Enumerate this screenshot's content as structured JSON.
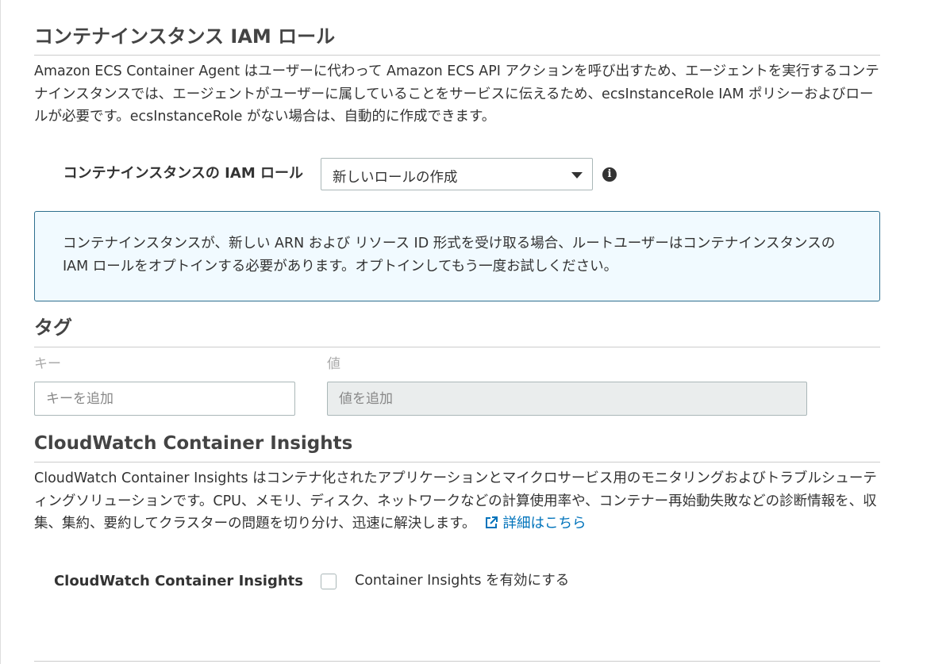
{
  "iam_section": {
    "title": "コンテナインスタンス IAM ロール",
    "description": "Amazon ECS Container Agent はユーザーに代わって Amazon ECS API アクションを呼び出すため、エージェントを実行するコンテナインスタンスでは、エージェントがユーザーに属していることをサービスに伝えるため、ecsInstanceRole IAM ポリシーおよびロールが必要です。ecsInstanceRole がない場合は、自動的に作成できます。",
    "role_label": "コンテナインスタンスの IAM ロール",
    "role_select_value": "新しいロールの作成",
    "info_icon": "info-icon",
    "notice": "コンテナインスタンスが、新しい ARN および リソース ID 形式を受け取る場合、ルートユーザーはコンテナインスタンスの IAM ロールをオプトインする必要があります。オプトインしてもう一度お試しください。"
  },
  "tags_section": {
    "title": "タグ",
    "key_label": "キー",
    "value_label": "値",
    "key_placeholder": "キーを追加",
    "value_placeholder": "値を追加"
  },
  "insights_section": {
    "title": "CloudWatch Container Insights",
    "description": "CloudWatch Container Insights はコンテナ化されたアプリケーションとマイクロサービス用のモニタリングおよびトラブルシューティングソリューションです。CPU、メモリ、ディスク、ネットワークなどの計算使用率や、コンテナー再始動失敗などの診断情報を、収集、集約、要約してクラスターの問題を切り分け、迅速に解決します。",
    "learn_more_link": "詳細はこちら",
    "link_icon": "external-link-icon",
    "checkbox_label_prefix": "CloudWatch Container Insights",
    "checkbox_text": "Container Insights を有効にする",
    "checkbox_checked": false
  },
  "colors": {
    "link": "#0073bb",
    "info_border": "#2e6f8e",
    "info_background": "#f1faff",
    "input_border": "#aab7b8"
  }
}
